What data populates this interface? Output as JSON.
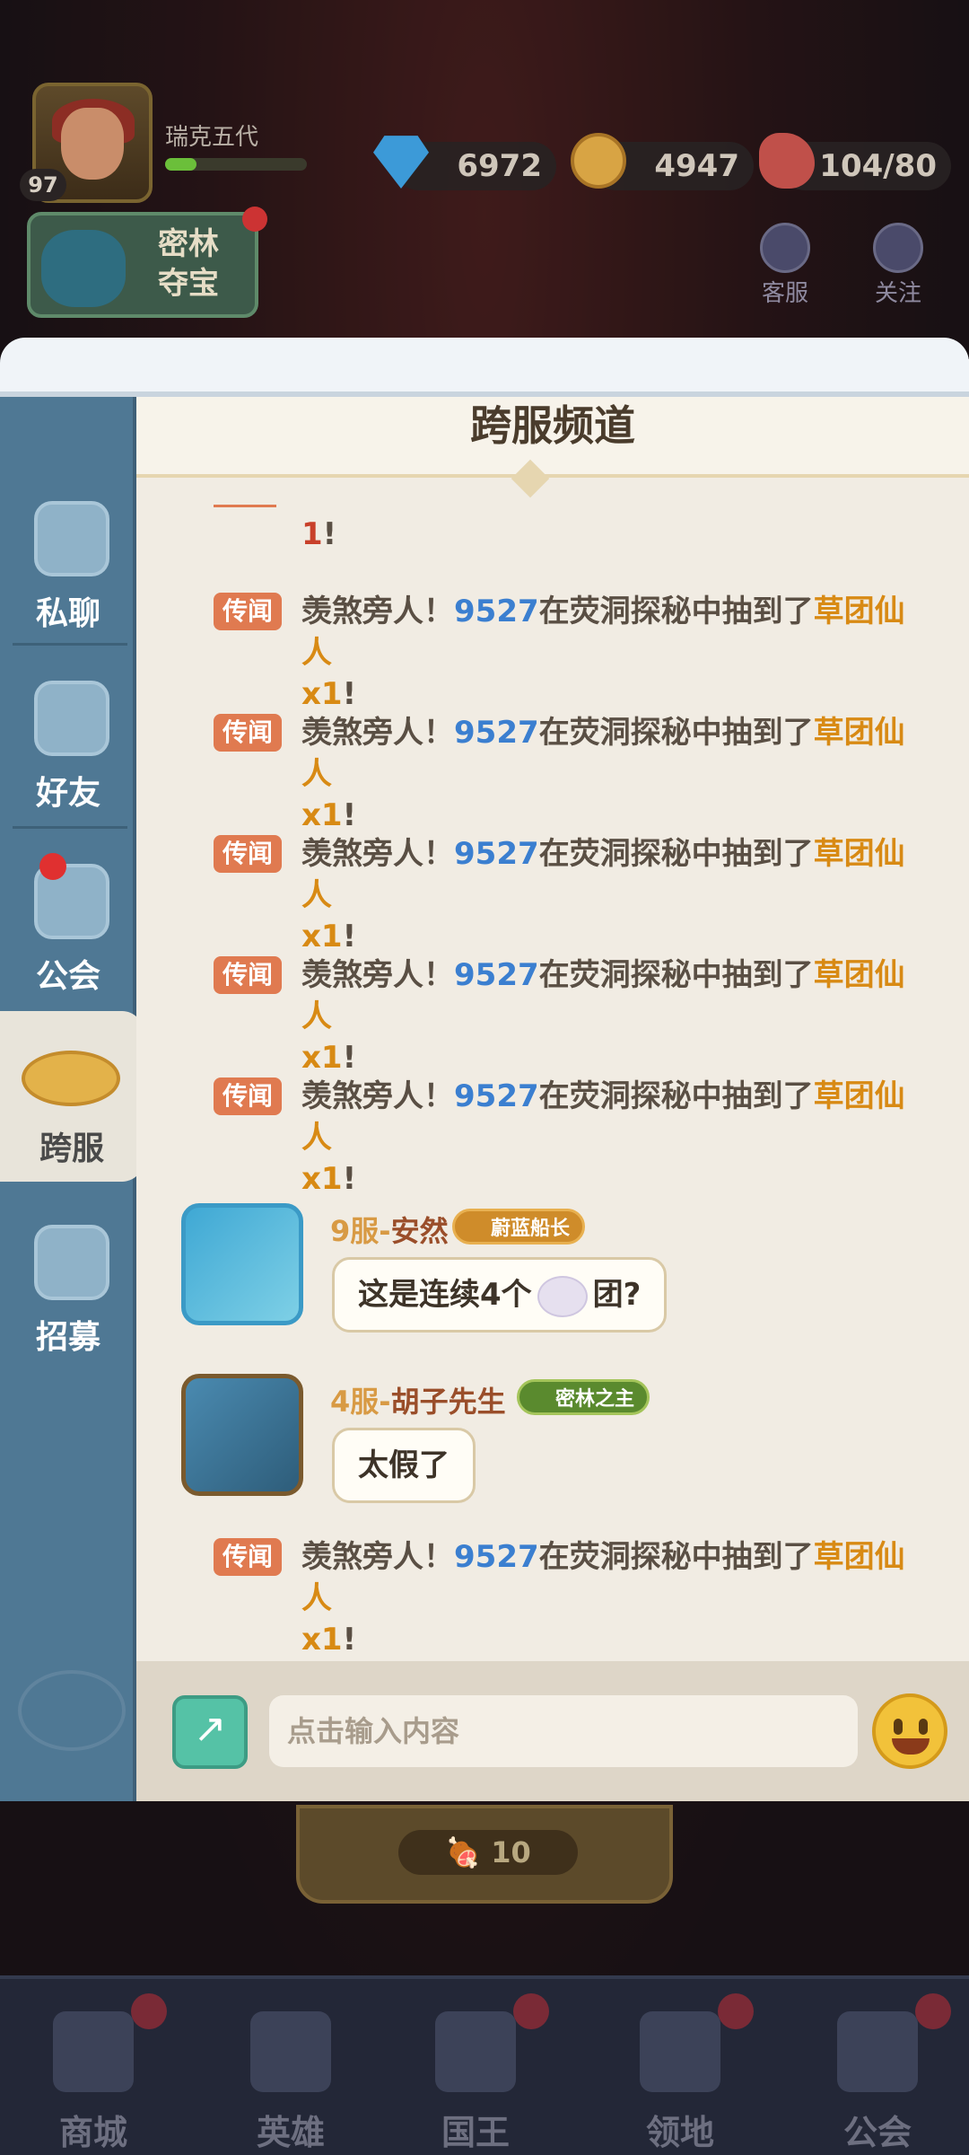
{
  "player": {
    "name": "瑞克五代",
    "level": "97",
    "xp_fraction": 0.22
  },
  "resources": {
    "gems": "6972",
    "gold": "4947",
    "stamina": "104/80"
  },
  "event": {
    "label_line1": "密林",
    "label_line2": "夺宝"
  },
  "top_buttons": {
    "service": "客服",
    "follow": "关注"
  },
  "chat": {
    "title": "跨服频道",
    "rumor_tag": "传闻",
    "sidebar": [
      {
        "label": "私聊",
        "icon": "chat-bubble-icon"
      },
      {
        "label": "好友",
        "icon": "friends-book-icon"
      },
      {
        "label": "公会",
        "icon": "guild-shield-icon"
      },
      {
        "label": "跨服",
        "icon": "planet-icon"
      },
      {
        "label": "招募",
        "icon": "handshake-icon"
      }
    ],
    "first_line_tail": {
      "num": "1",
      "punct": "!"
    },
    "rumor": {
      "prefix": "羡煞旁人！",
      "user": "9527",
      "middle": "在荧洞探秘中抽到了",
      "item": "草团仙人",
      "qty": "x1",
      "suffix": "!"
    },
    "user_messages": [
      {
        "server": "9服-",
        "name": "安然",
        "badge": "蔚蓝船长",
        "text_before": "这是连续4个",
        "text_after": "团?"
      },
      {
        "server": "4服-",
        "name": "胡子先生",
        "badge": "密林之主",
        "text": "太假了"
      }
    ],
    "input_placeholder": "点击输入内容"
  },
  "bottom_cost": "10",
  "nav": [
    {
      "label": "商城",
      "icon": "shop-icon"
    },
    {
      "label": "英雄",
      "icon": "helmet-icon"
    },
    {
      "label": "国王",
      "icon": "crown-icon"
    },
    {
      "label": "领地",
      "icon": "castle-icon"
    },
    {
      "label": "公会",
      "icon": "planet-icon"
    }
  ]
}
